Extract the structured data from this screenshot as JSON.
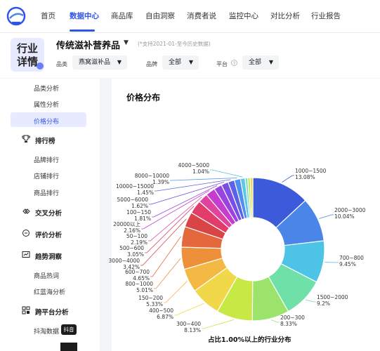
{
  "nav": {
    "items": [
      {
        "label": "首页",
        "active": false
      },
      {
        "label": "数据中心",
        "active": true
      },
      {
        "label": "商品库",
        "active": false
      },
      {
        "label": "自由洞察",
        "active": false
      },
      {
        "label": "消费者说",
        "active": false
      },
      {
        "label": "监控中心",
        "active": false
      },
      {
        "label": "对比分析",
        "active": false
      },
      {
        "label": "行业报告",
        "active": false
      }
    ],
    "accent": "#2f54eb"
  },
  "header": {
    "badge_line1": "行业",
    "badge_line2": "详情",
    "title": "传统滋补营养品",
    "hint": "(*支持2021-01-至今历史数据)",
    "filters": {
      "category_label": "品类",
      "category_value": "燕窝滋补品",
      "brand_label": "品牌",
      "brand_value": "全部",
      "platform_label": "平台",
      "platform_help": "?",
      "platform_value": "全部"
    }
  },
  "sidebar": {
    "top_items": [
      "品类分析",
      "属性分析",
      "价格分布"
    ],
    "active_item": "价格分布",
    "groups": [
      {
        "label": "排行榜",
        "icon": "trophy-icon",
        "items": [
          "品牌排行",
          "店铺排行",
          "商品排行"
        ]
      },
      {
        "label": "交叉分析",
        "icon": "cross-analysis-icon",
        "items": []
      },
      {
        "label": "评价分析",
        "icon": "review-icon",
        "items": []
      },
      {
        "label": "趋势洞察",
        "icon": "trend-icon",
        "items": [
          "商品热词",
          "红蓝海分析"
        ]
      },
      {
        "label": "跨平台分析",
        "icon": "cross-platform-icon",
        "items": [
          "抖淘数据"
        ]
      }
    ],
    "douyin_badge": "抖音"
  },
  "main": {
    "card_title": "价格分布",
    "caption": "占比1.00%以上的行业分布"
  },
  "chart_data": {
    "type": "pie",
    "donut": true,
    "title": "",
    "caption": "占比1.00%以上的行业分布",
    "slices": [
      {
        "label": "1000~1500",
        "value": 13.08,
        "display": "13.08%",
        "color": "#3b5bdb"
      },
      {
        "label": "2000~3000",
        "value": 10.04,
        "display": "10.04%",
        "color": "#4a86e8"
      },
      {
        "label": "700~800",
        "value": 9.45,
        "display": "9.45%",
        "color": "#4dc3e6"
      },
      {
        "label": "1500~2000",
        "value": 9.2,
        "display": "9.2%",
        "color": "#6fe0a8"
      },
      {
        "label": "200~300",
        "value": 8.33,
        "display": "8.33%",
        "color": "#9be36b"
      },
      {
        "label": "300~400",
        "value": 8.13,
        "display": "8.13%",
        "color": "#c7e845"
      },
      {
        "label": "400~500",
        "value": 6.87,
        "display": "6.87%",
        "color": "#f0d84a"
      },
      {
        "label": "150~200",
        "value": 5.33,
        "display": "5.33%",
        "color": "#f3b944"
      },
      {
        "label": "800~1000",
        "value": 5.01,
        "display": "5.01%",
        "color": "#ee8f3a"
      },
      {
        "label": "600~700",
        "value": 4.65,
        "display": "4.65%",
        "color": "#e4683b"
      },
      {
        "label": "3000~4000",
        "value": 3.42,
        "display": "3.42%",
        "color": "#d94545"
      },
      {
        "label": "500~600",
        "value": 3.05,
        "display": "3.05%",
        "color": "#e23c6b"
      },
      {
        "label": "50~100",
        "value": 2.19,
        "display": "2.19%",
        "color": "#e042a0"
      },
      {
        "label": "20000以上",
        "value": 2.16,
        "display": "2.16%",
        "color": "#c53ccf"
      },
      {
        "label": "100~150",
        "value": 1.81,
        "display": "1.81%",
        "color": "#9a44e0"
      },
      {
        "label": "5000~6000",
        "value": 1.62,
        "display": "1.62%",
        "color": "#7a4ee4"
      },
      {
        "label": "10000~15000",
        "value": 1.45,
        "display": "1.45%",
        "color": "#5b62e6"
      },
      {
        "label": "8000~10000",
        "value": 1.39,
        "display": "1.39%",
        "color": "#4f8fef"
      },
      {
        "label": "4000~5000",
        "value": 1.04,
        "display": "1.04%",
        "color": "#5cc6e8"
      },
      {
        "label": "",
        "value": 0.6,
        "display": "",
        "color": "#7ee0b8"
      },
      {
        "label": "",
        "value": 0.55,
        "display": "",
        "color": "#b6e65a"
      },
      {
        "label": "",
        "value": 0.6,
        "display": "",
        "color": "#f2d34c"
      }
    ]
  }
}
